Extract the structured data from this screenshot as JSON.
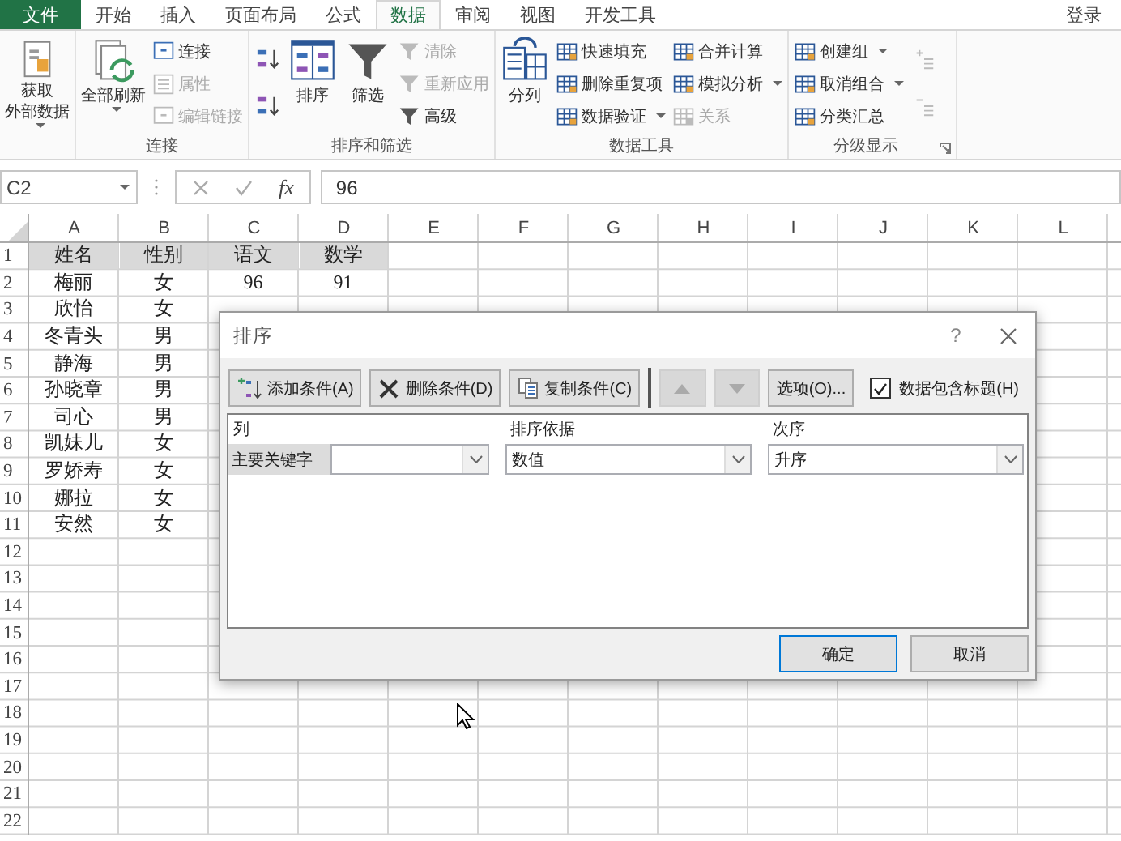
{
  "tabs": [
    {
      "label": "文件",
      "kind": "file",
      "selected": false
    },
    {
      "label": "开始",
      "kind": "tab",
      "selected": false
    },
    {
      "label": "插入",
      "kind": "tab",
      "selected": false
    },
    {
      "label": "页面布局",
      "kind": "tab",
      "selected": false
    },
    {
      "label": "公式",
      "kind": "tab",
      "selected": false
    },
    {
      "label": "数据",
      "kind": "tab",
      "selected": true
    },
    {
      "label": "审阅",
      "kind": "tab",
      "selected": false
    },
    {
      "label": "视图",
      "kind": "tab",
      "selected": false
    },
    {
      "label": "开发工具",
      "kind": "tab",
      "selected": false
    }
  ],
  "account": "登录",
  "ribbon_groups": [
    {
      "columns": [
        [
          {
            "kind": "large",
            "label_lines": [
              "获取",
              "外部数据"
            ],
            "dropdown": true,
            "disabled": false
          }
        ]
      ]
    },
    {
      "label": "连接",
      "columns": [
        [
          {
            "kind": "large",
            "label": "全部刷新",
            "dropdown": true,
            "disabled": false
          }
        ],
        [
          {
            "kind": "small",
            "label": "连接",
            "dropdown": false,
            "disabled": false
          },
          {
            "kind": "small",
            "label": "属性",
            "dropdown": false,
            "disabled": true
          },
          {
            "kind": "small",
            "label": "编辑链接",
            "dropdown": false,
            "disabled": true
          }
        ]
      ]
    },
    {
      "label": "排序和筛选",
      "columns": [
        [
          {
            "kind": "icon",
            "dropdown": false,
            "disabled": false
          },
          {
            "kind": "icon",
            "dropdown": false,
            "disabled": false
          }
        ],
        [
          {
            "kind": "large",
            "label": "排序",
            "dropdown": false,
            "disabled": false
          }
        ],
        [
          {
            "kind": "large",
            "label": "筛选",
            "dropdown": false,
            "disabled": false
          }
        ],
        [
          {
            "kind": "small",
            "label": "清除",
            "dropdown": false,
            "disabled": true
          },
          {
            "kind": "small",
            "label": "重新应用",
            "dropdown": false,
            "disabled": true
          },
          {
            "kind": "small",
            "label": "高级",
            "dropdown": false,
            "disabled": false
          }
        ]
      ]
    },
    {
      "label": "数据工具",
      "columns": [
        [
          {
            "kind": "large",
            "label": "分列",
            "dropdown": false,
            "disabled": false
          }
        ],
        [
          {
            "kind": "small",
            "label": "快速填充",
            "dropdown": false,
            "disabled": false
          },
          {
            "kind": "small",
            "label": "删除重复项",
            "dropdown": false,
            "disabled": false
          },
          {
            "kind": "small",
            "label": "数据验证",
            "dropdown": true,
            "disabled": false
          }
        ],
        [
          {
            "kind": "small",
            "label": "合并计算",
            "dropdown": false,
            "disabled": false
          },
          {
            "kind": "small",
            "label": "模拟分析",
            "dropdown": true,
            "disabled": false
          },
          {
            "kind": "small",
            "label": "关系",
            "dropdown": false,
            "disabled": true
          }
        ]
      ]
    },
    {
      "label": "分级显示",
      "launcher": true,
      "columns": [
        [
          {
            "kind": "small",
            "label": "创建组",
            "dropdown": true,
            "disabled": false
          },
          {
            "kind": "small",
            "label": "取消组合",
            "dropdown": true,
            "disabled": false
          },
          {
            "kind": "small",
            "label": "分类汇总",
            "dropdown": false,
            "disabled": false
          }
        ],
        [
          {
            "kind": "icon",
            "dropdown": false,
            "disabled": true
          },
          {
            "kind": "icon",
            "dropdown": false,
            "disabled": true
          }
        ]
      ]
    }
  ],
  "formula_bar": {
    "name_box": "C2",
    "function_label": "fx",
    "value": "96"
  },
  "sheet": {
    "columns": [
      "A",
      "B",
      "C",
      "D",
      "E",
      "F",
      "G",
      "H",
      "I",
      "J",
      "K",
      "L"
    ],
    "rows": [
      {
        "number": "1",
        "kind": "header",
        "cells": [
          "姓名",
          "性别",
          "语文",
          "数学"
        ]
      },
      {
        "number": "2",
        "kind": "data",
        "cells": [
          "梅丽",
          "女",
          "96",
          "91"
        ]
      },
      {
        "number": "3",
        "kind": "data",
        "cells": [
          "欣怡",
          "女"
        ]
      },
      {
        "number": "4",
        "kind": "data",
        "cells": [
          "冬青头",
          "男"
        ]
      },
      {
        "number": "5",
        "kind": "data",
        "cells": [
          "静海",
          "男"
        ]
      },
      {
        "number": "6",
        "kind": "data",
        "cells": [
          "孙晓章",
          "男"
        ]
      },
      {
        "number": "7",
        "kind": "data",
        "cells": [
          "司心",
          "男"
        ]
      },
      {
        "number": "8",
        "kind": "data",
        "cells": [
          "凯妹儿",
          "女"
        ]
      },
      {
        "number": "9",
        "kind": "data",
        "cells": [
          "罗娇寿",
          "女"
        ]
      },
      {
        "number": "10",
        "kind": "data",
        "cells": [
          "娜拉",
          "女"
        ]
      },
      {
        "number": "11",
        "kind": "data",
        "cells": [
          "安然",
          "女"
        ]
      },
      {
        "number": "12"
      },
      {
        "number": "13"
      },
      {
        "number": "14"
      },
      {
        "number": "15"
      },
      {
        "number": "16"
      },
      {
        "number": "17"
      },
      {
        "number": "18"
      },
      {
        "number": "19"
      },
      {
        "number": "20"
      },
      {
        "number": "21"
      },
      {
        "number": "22"
      }
    ]
  },
  "dialog": {
    "title": "排序",
    "help": "?",
    "toolbar": [
      {
        "kind": "add",
        "label": "添加条件(A)",
        "disabled": false
      },
      {
        "kind": "delete",
        "label": "删除条件(D)",
        "disabled": false
      },
      {
        "kind": "copy",
        "label": "复制条件(C)",
        "disabled": false
      },
      {
        "kind": "move_up",
        "disabled": true
      },
      {
        "kind": "move_down",
        "disabled": true
      },
      {
        "kind": "text",
        "label": "选项(O)...",
        "disabled": false
      }
    ],
    "header_checkbox": {
      "label": "数据包含标题(H)",
      "checked": true
    },
    "columns": [
      "列",
      "排序依据",
      "次序"
    ],
    "levels": [
      {
        "label": "主要关键字",
        "sort_on": "数值",
        "order": "升序"
      }
    ],
    "buttons": [
      "确定",
      "取消"
    ]
  }
}
